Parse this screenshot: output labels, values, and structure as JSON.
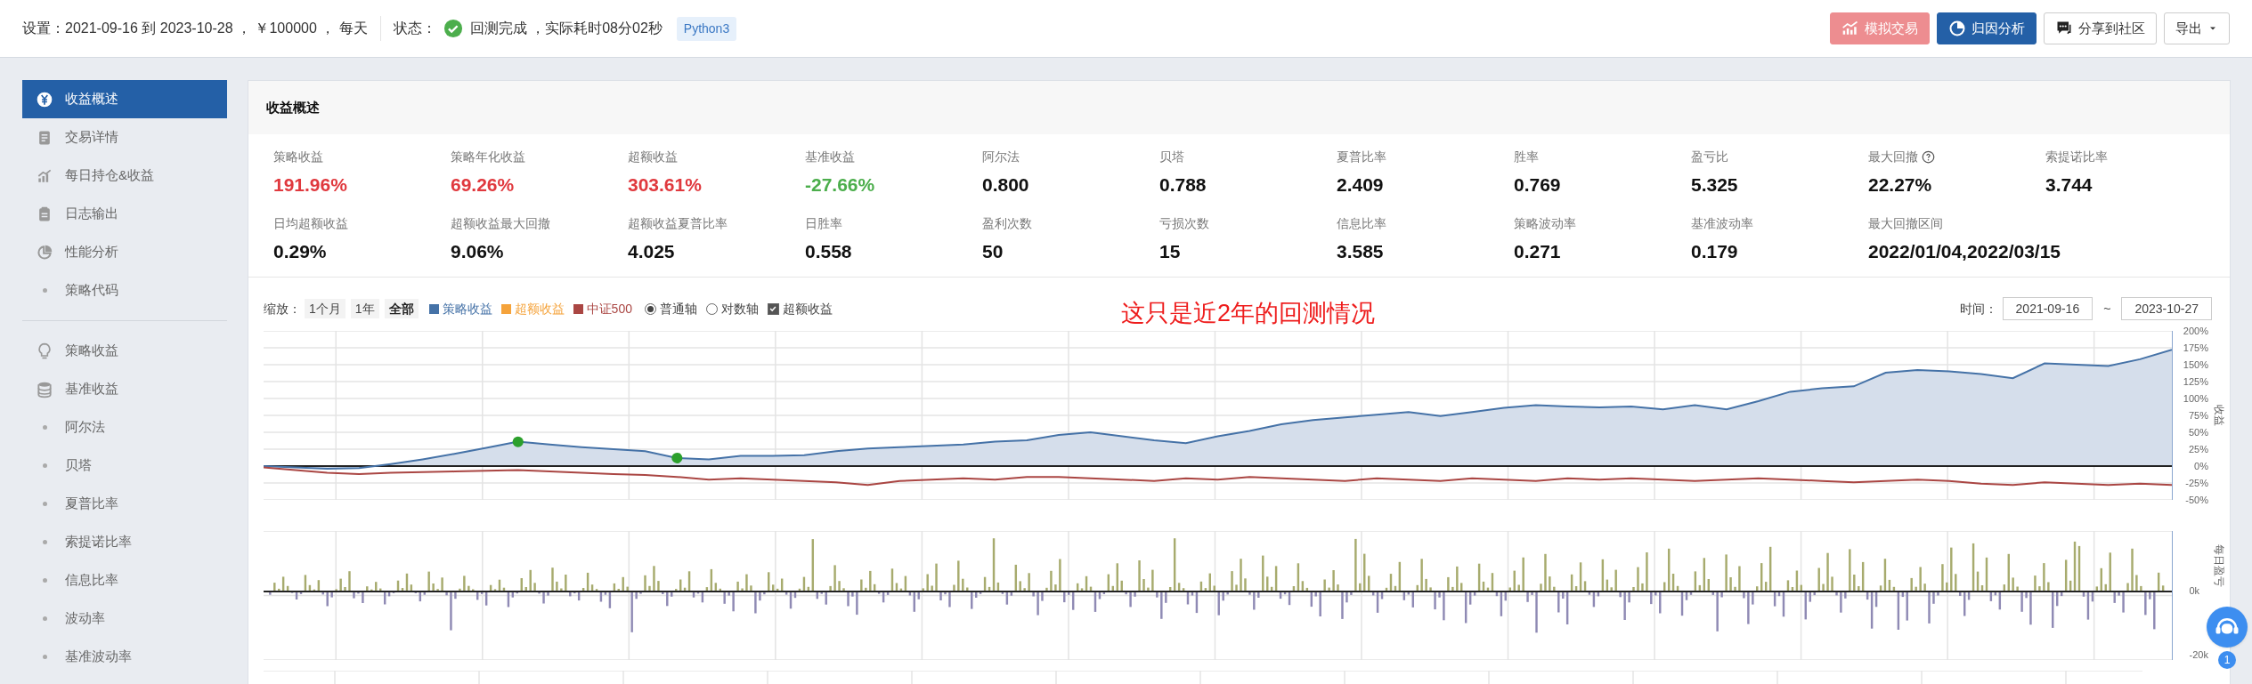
{
  "top_bar": {
    "settings": "设置：2021-09-16 到 2023-10-28 ， ￥100000 ， 每天",
    "status_label": "状态：",
    "status_text": "回测完成 ，实际耗时08分02秒",
    "language": "Python3",
    "buttons": [
      {
        "label": "模拟交易",
        "kind": "paper",
        "disabled": true
      },
      {
        "label": "归因分析",
        "kind": "primary",
        "disabled": false
      },
      {
        "label": "分享到社区",
        "kind": "share",
        "disabled": false
      },
      {
        "label": "导出",
        "kind": "dropdown",
        "disabled": false
      }
    ]
  },
  "sidebar": {
    "groups": [
      [
        {
          "label": "收益概述",
          "kind": "section",
          "selected": true
        },
        {
          "label": "交易详情",
          "kind": "section",
          "selected": false
        },
        {
          "label": "每日持仓&收益",
          "kind": "section",
          "selected": false
        },
        {
          "label": "日志输出",
          "kind": "section",
          "selected": false
        },
        {
          "label": "性能分析",
          "kind": "section",
          "selected": false
        },
        {
          "label": "策略代码",
          "kind": "sub",
          "selected": false
        }
      ],
      [
        {
          "label": "策略收益",
          "kind": "section",
          "selected": false
        },
        {
          "label": "基准收益",
          "kind": "section",
          "selected": false
        },
        {
          "label": "阿尔法",
          "kind": "sub",
          "selected": false
        },
        {
          "label": "贝塔",
          "kind": "sub",
          "selected": false
        },
        {
          "label": "夏普比率",
          "kind": "sub",
          "selected": false
        },
        {
          "label": "索提诺比率",
          "kind": "sub",
          "selected": false
        },
        {
          "label": "信息比率",
          "kind": "sub",
          "selected": false
        },
        {
          "label": "波动率",
          "kind": "sub",
          "selected": false
        },
        {
          "label": "基准波动率",
          "kind": "sub",
          "selected": false
        }
      ]
    ]
  },
  "panel": {
    "title": "收益概述",
    "metrics": [
      [
        {
          "label": "策略收益",
          "value": "191.96%",
          "color": "#e0393e",
          "help": false
        },
        {
          "label": "策略年化收益",
          "value": "69.26%",
          "color": "#e0393e",
          "help": false
        },
        {
          "label": "超额收益",
          "value": "303.61%",
          "color": "#e0393e",
          "help": false
        },
        {
          "label": "基准收益",
          "value": "-27.66%",
          "color": "#4cae4c",
          "help": false
        },
        {
          "label": "阿尔法",
          "value": "0.800",
          "color": "#111111",
          "help": false
        },
        {
          "label": "贝塔",
          "value": "0.788",
          "color": "#111111",
          "help": false
        },
        {
          "label": "夏普比率",
          "value": "2.409",
          "color": "#111111",
          "help": false
        },
        {
          "label": "胜率",
          "value": "0.769",
          "color": "#111111",
          "help": false
        },
        {
          "label": "盈亏比",
          "value": "5.325",
          "color": "#111111",
          "help": false
        },
        {
          "label": "最大回撤",
          "value": "22.27%",
          "color": "#111111",
          "help": true
        },
        {
          "label": "索提诺比率",
          "value": "3.744",
          "color": "#111111",
          "help": false
        }
      ],
      [
        {
          "label": "日均超额收益",
          "value": "0.29%",
          "color": "#111111",
          "help": false
        },
        {
          "label": "超额收益最大回撤",
          "value": "9.06%",
          "color": "#111111",
          "help": false
        },
        {
          "label": "超额收益夏普比率",
          "value": "4.025",
          "color": "#111111",
          "help": false
        },
        {
          "label": "日胜率",
          "value": "0.558",
          "color": "#111111",
          "help": false
        },
        {
          "label": "盈利次数",
          "value": "50",
          "color": "#111111",
          "help": false
        },
        {
          "label": "亏损次数",
          "value": "15",
          "color": "#111111",
          "help": false
        },
        {
          "label": "信息比率",
          "value": "3.585",
          "color": "#111111",
          "help": false
        },
        {
          "label": "策略波动率",
          "value": "0.271",
          "color": "#111111",
          "help": false
        },
        {
          "label": "基准波动率",
          "value": "0.179",
          "color": "#111111",
          "help": false
        },
        {
          "label": "最大回撤区间",
          "value": "2022/01/04,2022/03/15",
          "color": "#111111",
          "help": false
        }
      ]
    ]
  },
  "chart_toolbar": {
    "zoom_label": "缩放：",
    "zoom_options": [
      {
        "label": "1个月",
        "selected": false
      },
      {
        "label": "1年",
        "selected": false
      },
      {
        "label": "全部",
        "selected": true
      }
    ],
    "legend": [
      {
        "label": "超额收益",
        "color": "#f5a33b"
      }
    ],
    "axis_modes": [
      {
        "label": "普通轴",
        "selected": true
      },
      {
        "label": "对数轴",
        "selected": false
      }
    ],
    "excess_toggle": {
      "label": "超额收益",
      "checked": true
    },
    "note": "这只是近2年的回测情况",
    "time_label": "时间：",
    "start_date": "2021-09-16",
    "separator": "~",
    "end_date": "2023-10-27"
  },
  "return_chart": {
    "chart_data": {
      "type": "area",
      "ylabel": "收益",
      "ylim": [
        -50,
        200
      ],
      "yticks": [
        {
          "value": 200,
          "label": "200%"
        },
        {
          "value": 175,
          "label": "175%"
        },
        {
          "value": 150,
          "label": "150%"
        },
        {
          "value": 125,
          "label": "125%"
        },
        {
          "value": 100,
          "label": "100%"
        },
        {
          "value": 75,
          "label": "75%"
        },
        {
          "value": 50,
          "label": "50%"
        },
        {
          "value": 25,
          "label": "25%"
        },
        {
          "value": 0,
          "label": "0%"
        },
        {
          "value": -25,
          "label": "-25%"
        },
        {
          "value": -50,
          "label": "-50%"
        }
      ],
      "series": [
        {
          "name": "策略收益",
          "color": "#4572a7",
          "type": "area",
          "values": [
            0,
            -2,
            -4,
            -3,
            3,
            10,
            18,
            27,
            36,
            32,
            28,
            25,
            22,
            12,
            10,
            15,
            15,
            16,
            22,
            26,
            28,
            30,
            32,
            36,
            38,
            46,
            50,
            44,
            38,
            34,
            44,
            52,
            62,
            68,
            72,
            76,
            80,
            74,
            80,
            86,
            90,
            88,
            87,
            88,
            84,
            90,
            84,
            96,
            110,
            115,
            118,
            138,
            142,
            140,
            136,
            130,
            152,
            150,
            148,
            158,
            172
          ]
        },
        {
          "name": "中证500",
          "color": "#aa4643",
          "type": "line",
          "values": [
            -2,
            -6,
            -10,
            -12,
            -10,
            -9,
            -8,
            -7,
            -6,
            -8,
            -10,
            -12,
            -13,
            -16,
            -20,
            -18,
            -20,
            -22,
            -24,
            -28,
            -22,
            -20,
            -18,
            -20,
            -16,
            -16,
            -18,
            -20,
            -22,
            -18,
            -20,
            -16,
            -18,
            -20,
            -22,
            -18,
            -20,
            -22,
            -18,
            -20,
            -22,
            -18,
            -20,
            -18,
            -20,
            -22,
            -20,
            -18,
            -20,
            -22,
            -24,
            -22,
            -20,
            -22,
            -26,
            -28,
            -24,
            -26,
            -28,
            -26,
            -28
          ]
        }
      ],
      "grid": true
    }
  },
  "pnl_chart": {
    "y_ticks": [
      "0k",
      "-20k"
    ],
    "axis_title": "每日盈亏"
  },
  "chat_badge": "1"
}
